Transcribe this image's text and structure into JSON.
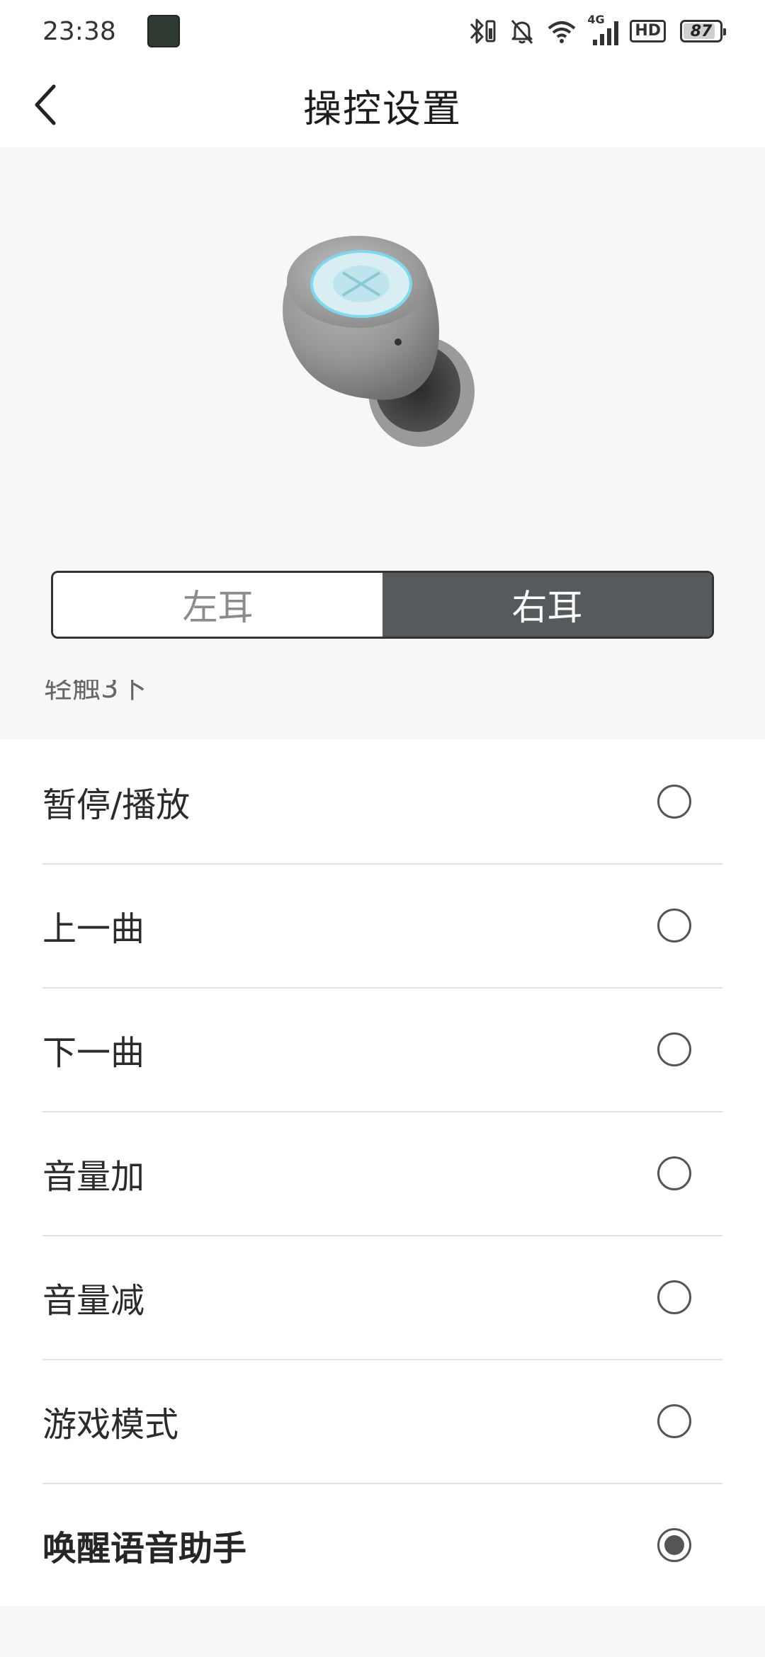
{
  "status_bar": {
    "time": "23:38",
    "network": "4G",
    "hd": "HD",
    "battery": "87",
    "battery_level": 0.87,
    "icons": [
      "bluetooth-battery-icon",
      "silent-bell-icon",
      "wifi-icon",
      "cellular-signal-icon",
      "battery-icon"
    ]
  },
  "header": {
    "title": "操控设置",
    "back_icon": "chevron-left-icon"
  },
  "earbud": {
    "image": "earbud-illustration"
  },
  "ear_selector": {
    "left": "左耳",
    "right": "右耳",
    "selected": "右耳"
  },
  "section_hint": "轻触3下",
  "options": [
    {
      "label": "暂停/播放",
      "checked": false
    },
    {
      "label": "上一曲",
      "checked": false
    },
    {
      "label": "下一曲",
      "checked": false
    },
    {
      "label": "音量加",
      "checked": false
    },
    {
      "label": "音量减",
      "checked": false
    },
    {
      "label": "游戏模式",
      "checked": false
    },
    {
      "label": "唤醒语音助手",
      "checked": true
    }
  ],
  "colors": {
    "segment_selected": "#565a5c",
    "background": "#f7f7f7",
    "accent_ring": "#7fd8ee"
  }
}
